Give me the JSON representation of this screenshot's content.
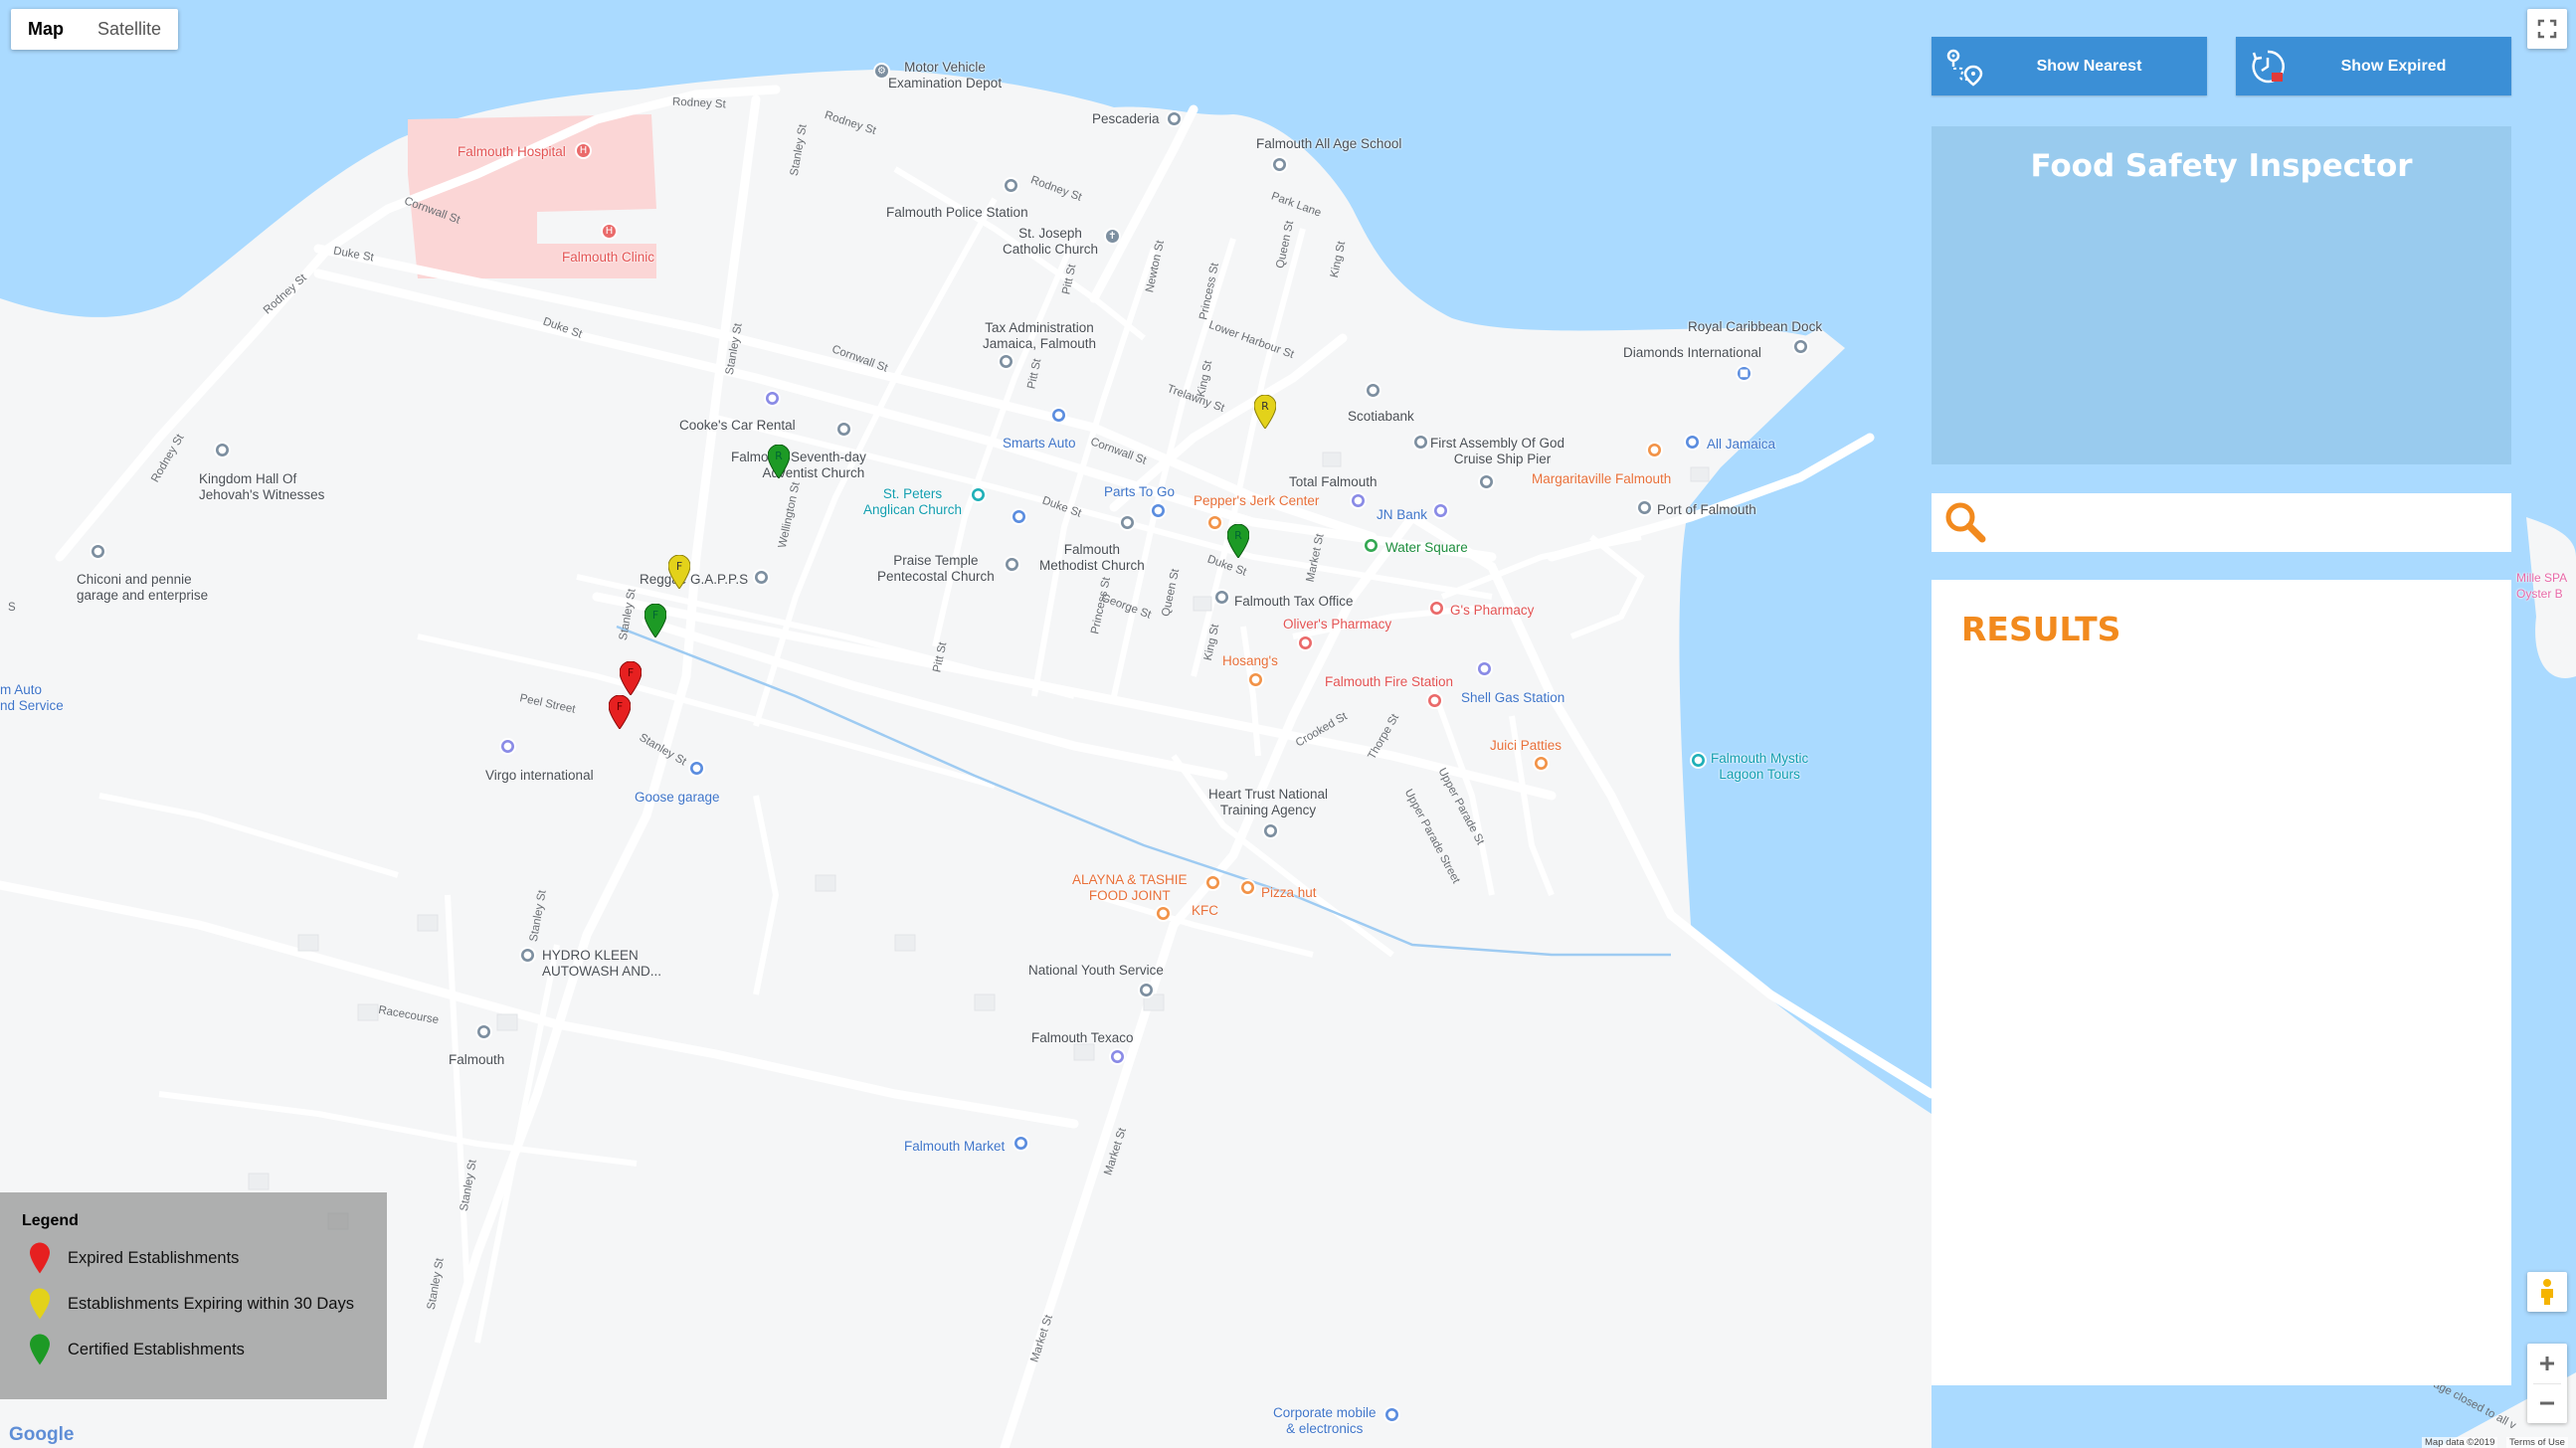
{
  "map_controls": {
    "type_map": "Map",
    "type_satellite": "Satellite",
    "google_logo": "Google",
    "map_data": "Map data ©2019",
    "terms": "Terms of Use"
  },
  "buttons": {
    "show_nearest": "Show Nearest",
    "show_expired": "Show Expired"
  },
  "app_title": "Food Safety Inspector",
  "search": {
    "value": "",
    "placeholder": ""
  },
  "results_heading": "RESULTS",
  "legend": {
    "title": "Legend",
    "items": [
      {
        "label": "Expired Establishments",
        "color": "#e62020"
      },
      {
        "label": "Establishments Expiring within 30 Days",
        "color": "#e3d21a"
      },
      {
        "label": "Certified Establishments",
        "color": "#1d9a25"
      }
    ]
  },
  "map_labels": {
    "motor_vehicle": [
      "Motor Vehicle",
      "Examination Depot"
    ],
    "pescaderia": "Pescaderia",
    "falmouth_hospital": "Falmouth Hospital",
    "falmouth_clinic": "Falmouth Clinic",
    "falmouth_all_age": "Falmouth All Age School",
    "police_station": "Falmouth Police Station",
    "st_joseph": [
      "St. Joseph",
      "Catholic Church"
    ],
    "tax_admin": [
      "Tax Administration",
      "Jamaica, Falmouth"
    ],
    "royal_caribbean": "Royal Caribbean Dock",
    "diamonds": "Diamonds International",
    "kingdom_hall": [
      "Kingdom Hall Of",
      "Jehovah's Witnesses"
    ],
    "cookes_car": "Cooke's Car Rental",
    "smarts_auto": "Smarts Auto",
    "scotiabank": "Scotiabank",
    "first_assembly": [
      "First Assembly Of God",
      "Cruise Ship Pier"
    ],
    "all_jamaica": "All Jamaica",
    "margaritaville": "Margaritaville Falmouth",
    "seventh_day": [
      "Falmouth Seventh-day",
      "Adventist Church"
    ],
    "total_falmouth": "Total Falmouth",
    "parts_to_go": "Parts To Go",
    "peppers": "Pepper's Jerk Center",
    "jn_bank": "JN Bank",
    "st_peters": [
      "St. Peters",
      "Anglican Church"
    ],
    "port_of_falmouth": "Port of Falmouth",
    "chiconi": [
      "Chiconi and pennie",
      "garage and enterprise"
    ],
    "water_square": "Water Square",
    "praise_temple": [
      "Praise Temple",
      "Pentecostal Church"
    ],
    "methodist": [
      "Falmouth",
      "Methodist Church"
    ],
    "reggae": "Reggae G.A.P.P.S",
    "tax_office": "Falmouth Tax Office",
    "gs_pharmacy": "G's Pharmacy",
    "olivers": "Oliver's Pharmacy",
    "auto_service": [
      "m Auto",
      "nd Service"
    ],
    "hosangs": "Hosang's",
    "fire_station": "Falmouth Fire Station",
    "shell": "Shell Gas Station",
    "virgo": "Virgo international",
    "goose": "Goose garage",
    "juici": "Juici Patties",
    "mystic": [
      "Falmouth Mystic",
      "Lagoon Tours"
    ],
    "heart_trust": [
      "Heart Trust National",
      "Training Agency"
    ],
    "alayna": [
      "ALAYNA & TASHIE",
      "FOOD JOINT"
    ],
    "pizza_hut": "Pizza hut",
    "kfc": "KFC",
    "hydro_kleen": [
      "HYDRO KLEEN",
      "AUTOWASH AND..."
    ],
    "national_youth": "National Youth Service",
    "falmouth": "Falmouth",
    "falmouth_texaco": "Falmouth Texaco",
    "falmouth_market": "Falmouth Market",
    "corporate_mobile": [
      "Corporate mobile",
      "& electronics"
    ],
    "spa": [
      "Mille SPA",
      "Oyster B"
    ],
    "closed": "age closed to all v"
  },
  "streets": {
    "rodney1": "Rodney St",
    "rodney2": "Rodney St",
    "rodney3": "Rodney St",
    "rodney4": "Rodney St",
    "rodney5": "Rodney St",
    "cornwall1": "Cornwall St",
    "cornwall2": "Cornwall St",
    "cornwall3": "Cornwall St",
    "duke1": "Duke St",
    "duke2": "Duke St",
    "duke3": "Duke St",
    "duke4": "Duke St",
    "stanley1": "Stanley St",
    "stanley2": "Stanley St",
    "stanley3": "Stanley St",
    "stanley4": "Stanley St",
    "stanley5": "Stanley St",
    "stanley6": "Stanley St",
    "stanley7": "Stanley St",
    "park": "Park Lane",
    "queen1": "Queen St",
    "queen2": "Queen St",
    "king1": "King St",
    "king2": "King St",
    "king3": "King St",
    "pitt1": "Pitt St",
    "pitt2": "Pitt St",
    "pitt3": "Pitt St",
    "newton": "Newton St",
    "princess1": "Princess St",
    "princess2": "Princess St",
    "lower_harbour": "Lower Harbour St",
    "trelawny": "Trelawny St",
    "wellington": "Wellington St",
    "george": "George St",
    "market1": "Market St",
    "market2": "Market St",
    "market3": "Market St",
    "peel": "Peel Street",
    "crooked": "Crooked St",
    "thorpe": "Thorpe St",
    "upper_parade": "Upper Parade St",
    "upper_parade_street": "Upper Parade Street",
    "racecourse": "Racecourse",
    "s_label": "S"
  },
  "markers": [
    {
      "letter": "R",
      "status": "expiring",
      "color": "#e3d21a"
    },
    {
      "letter": "R",
      "status": "certified",
      "color": "#1d9a25"
    },
    {
      "letter": "R",
      "status": "certified",
      "color": "#1d9a25"
    },
    {
      "letter": "F",
      "status": "expiring",
      "color": "#e3d21a"
    },
    {
      "letter": "F",
      "status": "certified",
      "color": "#1d9a25"
    },
    {
      "letter": "F",
      "status": "expired",
      "color": "#e62020"
    },
    {
      "letter": "F",
      "status": "expired",
      "color": "#e62020"
    }
  ],
  "colors": {
    "water": "#aadaff",
    "land": "#f5f6f7",
    "button_blue": "#3b8fd6",
    "results_orange": "#f28a1e",
    "hospital_area": "#fbd6d6"
  }
}
